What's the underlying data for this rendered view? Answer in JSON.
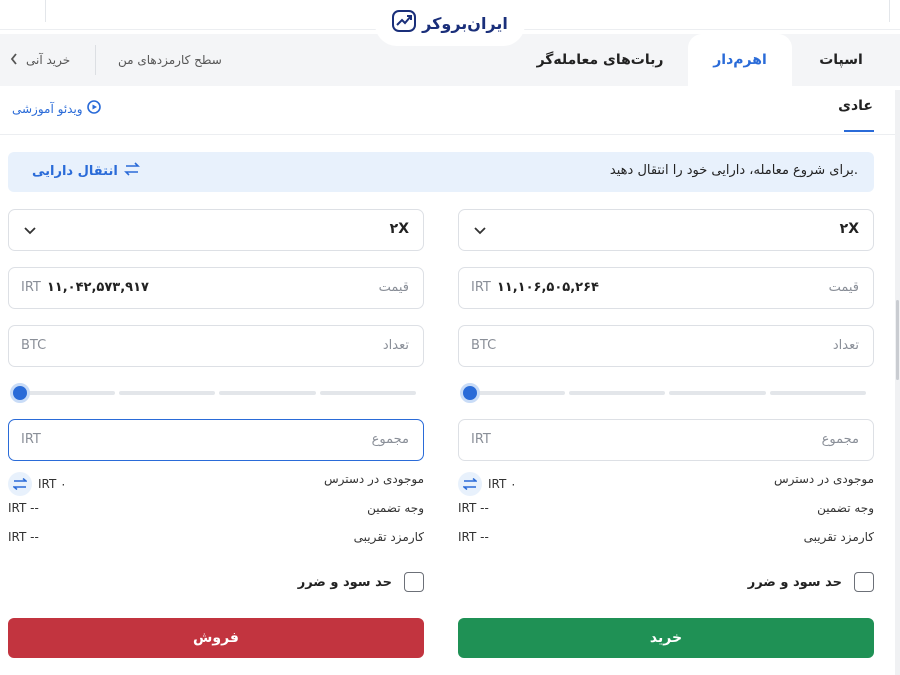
{
  "brand": {
    "logo_text": "ایران‌بروکر"
  },
  "tabs": [
    {
      "label": "اسپات",
      "active": false
    },
    {
      "label": "اهرم‌دار",
      "active": true
    },
    {
      "label": "ربات‌های معامله‌گر",
      "active": false
    }
  ],
  "header_links": {
    "fees_level": "سطح کارمزدهای من",
    "instant_buy": "خرید آنی"
  },
  "subtabs": {
    "normal": "عادی",
    "video_tutorial": "ویدئو آموزشی"
  },
  "banner": {
    "message": "برای شروع معامله، دارایی خود را انتقال دهید.",
    "transfer_button": "انتقال دارایی"
  },
  "buy_panel": {
    "leverage": "۲X",
    "price_label": "قیمت",
    "price_value": "۱۱,۱۰۶,۵۰۵,۲۶۴",
    "currency": "IRT",
    "amount_label": "تعداد",
    "amount_unit": "BTC",
    "total_label": "مجموع",
    "total_unit": "IRT",
    "slider_value": 0,
    "available_label": "موجودی در دسترس",
    "available_value": "IRT ۰",
    "collateral_label": "وجه تضمین",
    "collateral_value": "IRT --",
    "fee_label": "کارمزد تقریبی",
    "fee_value": "IRT --",
    "tp_sl_label": "حد سود و ضرر",
    "submit": "خرید"
  },
  "sell_panel": {
    "leverage": "۲X",
    "price_label": "قیمت",
    "price_value": "۱۱,۰۴۲,۵۷۳,۹۱۷",
    "currency": "IRT",
    "amount_label": "تعداد",
    "amount_unit": "BTC",
    "total_label": "مجموع",
    "total_unit": "IRT",
    "slider_value": 0,
    "available_label": "موجودی در دسترس",
    "available_value": "IRT ۰",
    "collateral_label": "وجه تضمین",
    "collateral_value": "IRT --",
    "fee_label": "کارمزد تقریبی",
    "fee_value": "IRT --",
    "tp_sl_label": "حد سود و ضرر",
    "submit": "فروش"
  },
  "colors": {
    "accent": "#2a6bd8",
    "buy": "#1f9155",
    "sell": "#c2343f",
    "banner_bg": "#e8f1fc"
  },
  "icons": [
    "logo-chart-icon",
    "chevron-left-icon",
    "play-circle-icon",
    "swap-arrows-icon",
    "chevron-down-icon"
  ]
}
